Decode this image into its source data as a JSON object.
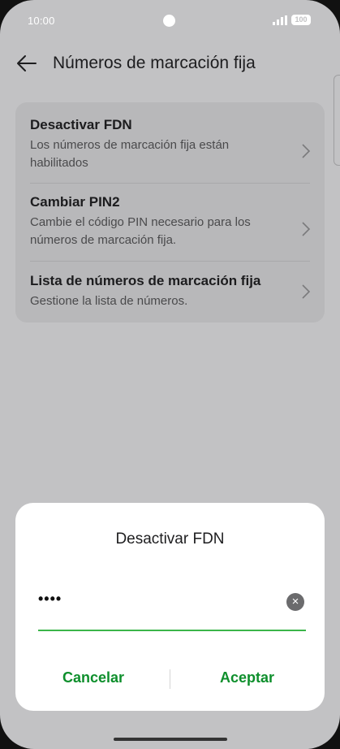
{
  "status": {
    "time": "10:00",
    "battery": "100"
  },
  "header": {
    "title": "Números de marcación fija"
  },
  "items": [
    {
      "title": "Desactivar FDN",
      "subtitle": "Los números de marcación fija están habilitados"
    },
    {
      "title": "Cambiar PIN2",
      "subtitle": "Cambie el código PIN necesario para los números de marcación fija."
    },
    {
      "title": "Lista de números de marcación fija",
      "subtitle": "Gestione la lista de números."
    }
  ],
  "dialog": {
    "title": "Desactivar FDN",
    "password_mask": "••••",
    "cancel": "Cancelar",
    "accept": "Aceptar"
  },
  "colors": {
    "accent": "#0e8f2c",
    "underline": "#3bb54a"
  }
}
